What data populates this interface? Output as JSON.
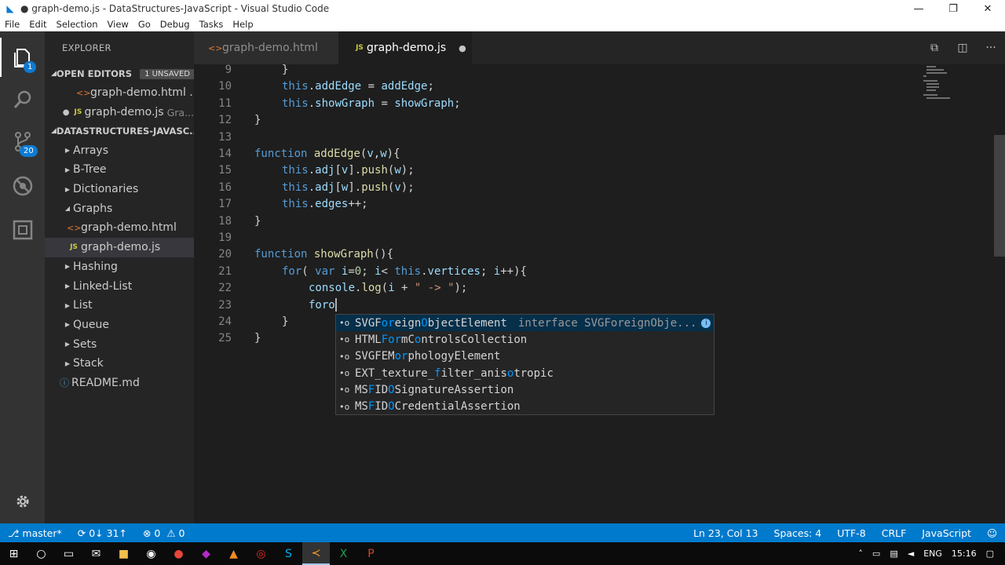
{
  "window": {
    "title": "● graph-demo.js - DataStructures-JavaScript - Visual Studio Code",
    "minimize_icon": "minimize-icon",
    "restore_icon": "restore-icon",
    "close_icon": "close-icon"
  },
  "menu": [
    "File",
    "Edit",
    "Selection",
    "View",
    "Go",
    "Debug",
    "Tasks",
    "Help"
  ],
  "activity": {
    "explorer_badge": "1",
    "scm_badge": "20"
  },
  "sidebar": {
    "title": "EXPLORER",
    "open_editors": {
      "label": "OPEN EDITORS",
      "badge": "1 UNSAVED",
      "items": [
        {
          "name": "graph-demo.html ...",
          "desc": ""
        },
        {
          "name": "graph-demo.js",
          "desc": "Gra..."
        }
      ]
    },
    "project": {
      "label": "DATASTRUCTURES-JAVASC...",
      "folders": [
        "Arrays",
        "B-Tree",
        "Dictionaries",
        "Graphs"
      ],
      "graphs_children": [
        "graph-demo.html",
        "graph-demo.js"
      ],
      "folders_after": [
        "Hashing",
        "Linked-List",
        "List",
        "Queue",
        "Sets",
        "Stack"
      ],
      "readme": "README.md"
    }
  },
  "tabs": [
    {
      "label": "graph-demo.html",
      "active": false
    },
    {
      "label": "graph-demo.js",
      "active": true,
      "modified": true
    }
  ],
  "editor": {
    "lines": [
      {
        "n": "9",
        "text": "}"
      },
      {
        "n": "10",
        "text": "this.addEdge = addEdge;"
      },
      {
        "n": "11",
        "text": "this.showGraph = showGraph;"
      },
      {
        "n": "12",
        "text": "}"
      },
      {
        "n": "13",
        "text": ""
      },
      {
        "n": "14",
        "text": "function addEdge(v,w){"
      },
      {
        "n": "15",
        "text": "this.adj[v].push(w);"
      },
      {
        "n": "16",
        "text": "this.adj[w].push(v);"
      },
      {
        "n": "17",
        "text": "this.edges++;"
      },
      {
        "n": "18",
        "text": "}"
      },
      {
        "n": "19",
        "text": ""
      },
      {
        "n": "20",
        "text": "function showGraph(){"
      },
      {
        "n": "21",
        "text": "for( var i=0; i< this.vertices; i++){"
      },
      {
        "n": "22",
        "text": "console.log(i + \" -> \");"
      },
      {
        "n": "23",
        "text": "foro"
      },
      {
        "n": "24",
        "text": "}"
      },
      {
        "n": "25",
        "text": "}"
      }
    ]
  },
  "suggestions": [
    {
      "pre": "SVGF",
      "hl": "or",
      "mid": "eign",
      "hl2": "O",
      "post": "bjectElement",
      "detail": "interface SVGForeignObje...",
      "selected": true
    },
    {
      "pre": "HTML",
      "hl": "For",
      "mid": "mC",
      "hl2": "o",
      "post": "ntrolsCollection",
      "detail": "",
      "selected": false
    },
    {
      "pre": "SVGF",
      "hl": "",
      "mid": "EM",
      "hl2": "or",
      "post": "phologyElement",
      "detail": "",
      "selected": false
    },
    {
      "pre": "EXT_texture_",
      "hl": "f",
      "mid": "ilter_anis",
      "hl2": "o",
      "post": "tropic",
      "detail": "",
      "selected": false
    },
    {
      "pre": "MS",
      "hl": "F",
      "mid": "ID",
      "hl2": "O",
      "post": "SignatureAssertion",
      "detail": "",
      "selected": false
    },
    {
      "pre": "MS",
      "hl": "F",
      "mid": "ID",
      "hl2": "O",
      "post": "CredentialAssertion",
      "detail": "",
      "selected": false
    }
  ],
  "status": {
    "branch": "master*",
    "sync": "0↓ 31↑",
    "errors": "0",
    "warnings": "0",
    "position": "Ln 23, Col 13",
    "spaces": "Spaces: 4",
    "encoding": "UTF-8",
    "eol": "CRLF",
    "language": "JavaScript"
  },
  "taskbar": {
    "lang": "ENG",
    "time": "15:16"
  },
  "colors": {
    "status_bar": "#007acc",
    "keyword": "#569cd6",
    "function": "#dcdcaa",
    "variable": "#9cdcfe",
    "string": "#ce9178",
    "number": "#b5cea8"
  }
}
